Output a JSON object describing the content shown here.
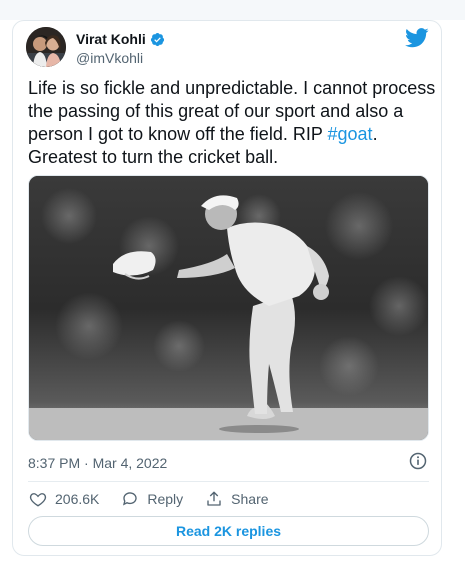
{
  "tweet": {
    "display_name": "Virat Kohli",
    "handle": "@imVkohli",
    "text_main": "Life is so fickle and unpredictable. I cannot process the passing of this great of our sport and also a person I got to know off the field. RIP ",
    "hashtag": "#goat",
    "text_tail": ". Greatest to turn the cricket ball.",
    "timestamp": "8:37 PM · Mar 4, 2022",
    "verified": true
  },
  "actions": {
    "likes": "206.6K",
    "reply_label": "Reply",
    "share_label": "Share"
  },
  "read_replies_label": "Read 2K replies",
  "colors": {
    "accent": "#1b95e0",
    "like_icon": "#536471",
    "border": "#e1e8ed"
  },
  "icons": [
    "twitter-bird-icon",
    "verified-badge-icon",
    "info-icon",
    "heart-icon",
    "reply-icon",
    "share-icon"
  ]
}
